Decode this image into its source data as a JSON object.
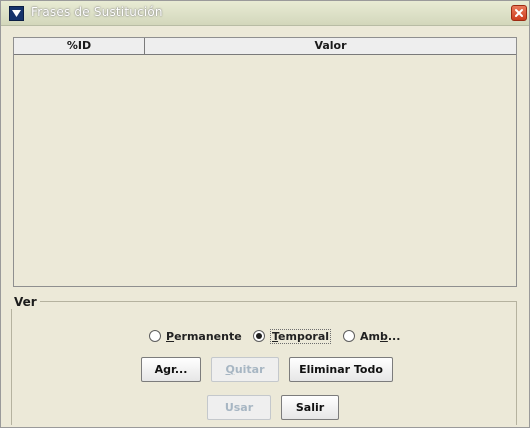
{
  "window": {
    "title": "Frases de Sustitución"
  },
  "table": {
    "columns": [
      "%ID",
      "Valor"
    ],
    "rows": []
  },
  "view_group": {
    "label": "Ver",
    "options": [
      {
        "label": "Permanente",
        "mnemonic": "P",
        "rest": "ermanente",
        "checked": false
      },
      {
        "label": "Temporal",
        "mnemonic": "T",
        "rest": "emporal",
        "checked": true
      },
      {
        "label": "Amb...",
        "pre": "Am",
        "mnemonic": "b",
        "rest": "...",
        "checked": false
      }
    ]
  },
  "buttons": {
    "add": "Agr...",
    "remove": "Quitar",
    "remove_mnemonic": "Q",
    "remove_rest": "uitar",
    "remove_all": "Eliminar Todo",
    "use": "Usar",
    "exit": "Salir"
  }
}
